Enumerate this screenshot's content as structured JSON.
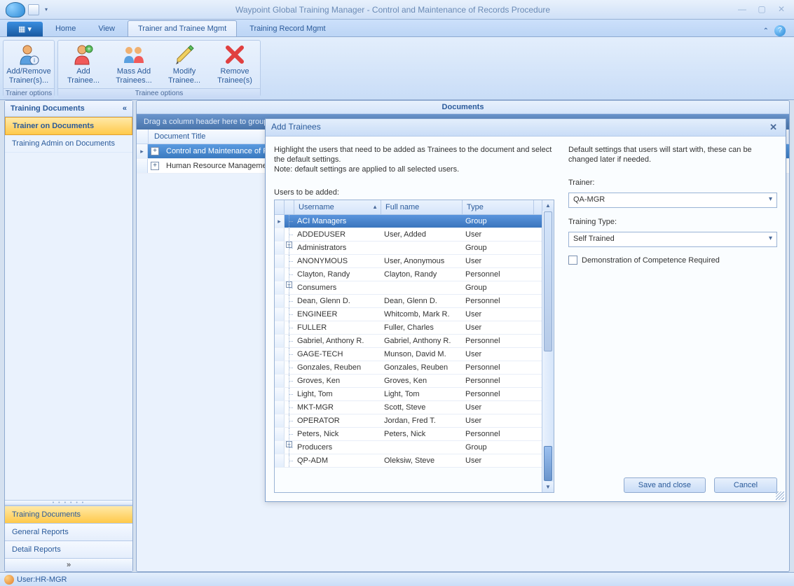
{
  "app": {
    "title": "Waypoint Global Training Manager - Control and Maintenance of Records Procedure"
  },
  "ribbon": {
    "app_menu_glyph": "▦ ▾",
    "tabs": {
      "home": "Home",
      "view": "View",
      "trainer": "Trainer and Trainee Mgmt",
      "record": "Training Record Mgmt"
    },
    "groups": {
      "trainer_options": "Trainer options",
      "trainee_options": "Trainee options"
    },
    "buttons": {
      "add_remove_trainers": "Add/Remove Trainer(s)...",
      "add_trainee": "Add Trainee...",
      "mass_add_trainees": "Mass Add Trainees...",
      "modify_trainee": "Modify Trainee...",
      "remove_trainees": "Remove Trainee(s)"
    },
    "collapse_glyph": "⌃",
    "help_glyph": "?"
  },
  "sidebar": {
    "header": "Training Documents",
    "collapse_glyph": "«",
    "items": [
      "Trainer on Documents",
      "Training Admin on Documents"
    ],
    "footers": [
      "Training Documents",
      "General Reports",
      "Detail Reports"
    ],
    "overflow_glyph": "»"
  },
  "main": {
    "panel_title": "Documents",
    "group_hint": "Drag a column header here to group",
    "columns": {
      "doc_title": "Document Title"
    },
    "rows": [
      {
        "title": "Control and Maintenance of Re",
        "selected": true,
        "expandable": true
      },
      {
        "title": "Human Resource Management",
        "selected": false,
        "expandable": true
      }
    ]
  },
  "dialog": {
    "title": "Add Trainees",
    "close_glyph": "✕",
    "hint": "Highlight the users that need to be added as Trainees to the document and select the default settings.\nNote: default settings are applied to all selected users.",
    "users_label": "Users to be added:",
    "columns": {
      "username": "Username",
      "fullname": "Full name",
      "type": "Type"
    },
    "col_widths": {
      "username": 124,
      "fullname": 116,
      "type": 102
    },
    "rows": [
      {
        "username": "ACI Managers",
        "fullname": "",
        "type": "Group",
        "selected": true,
        "expandable": false
      },
      {
        "username": "ADDEDUSER",
        "fullname": "User, Added",
        "type": "User"
      },
      {
        "username": "Administrators",
        "fullname": "",
        "type": "Group",
        "expandable": true
      },
      {
        "username": "ANONYMOUS",
        "fullname": "User, Anonymous",
        "type": "User"
      },
      {
        "username": "Clayton, Randy",
        "fullname": "Clayton, Randy",
        "type": "Personnel"
      },
      {
        "username": "Consumers",
        "fullname": "",
        "type": "Group",
        "expandable": true
      },
      {
        "username": "Dean, Glenn D.",
        "fullname": "Dean, Glenn D.",
        "type": "Personnel"
      },
      {
        "username": "ENGINEER",
        "fullname": "Whitcomb, Mark R.",
        "type": "User"
      },
      {
        "username": "FULLER",
        "fullname": "Fuller, Charles",
        "type": "User"
      },
      {
        "username": "Gabriel, Anthony R.",
        "fullname": "Gabriel, Anthony R.",
        "type": "Personnel"
      },
      {
        "username": "GAGE-TECH",
        "fullname": "Munson, David M.",
        "type": "User"
      },
      {
        "username": "Gonzales, Reuben",
        "fullname": "Gonzales, Reuben",
        "type": "Personnel"
      },
      {
        "username": "Groves, Ken",
        "fullname": "Groves, Ken",
        "type": "Personnel"
      },
      {
        "username": "Light, Tom",
        "fullname": "Light, Tom",
        "type": "Personnel"
      },
      {
        "username": "MKT-MGR",
        "fullname": "Scott, Steve",
        "type": "User"
      },
      {
        "username": "OPERATOR",
        "fullname": "Jordan, Fred T.",
        "type": "User"
      },
      {
        "username": "Peters, Nick",
        "fullname": "Peters, Nick",
        "type": "Personnel"
      },
      {
        "username": "Producers",
        "fullname": "",
        "type": "Group",
        "expandable": true
      },
      {
        "username": "QP-ADM",
        "fullname": "Oleksiw, Steve",
        "type": "User"
      }
    ],
    "settings_hint": "Default settings that users will start with, these can be changed later if needed.",
    "trainer_label": "Trainer:",
    "trainer_value": "QA-MGR",
    "training_type_label": "Training Type:",
    "training_type_value": "Self Trained",
    "competence_label": "Demonstration of Competence Required",
    "buttons": {
      "save": "Save and close",
      "cancel": "Cancel"
    }
  },
  "status": {
    "user_label": "User:HR-MGR"
  }
}
